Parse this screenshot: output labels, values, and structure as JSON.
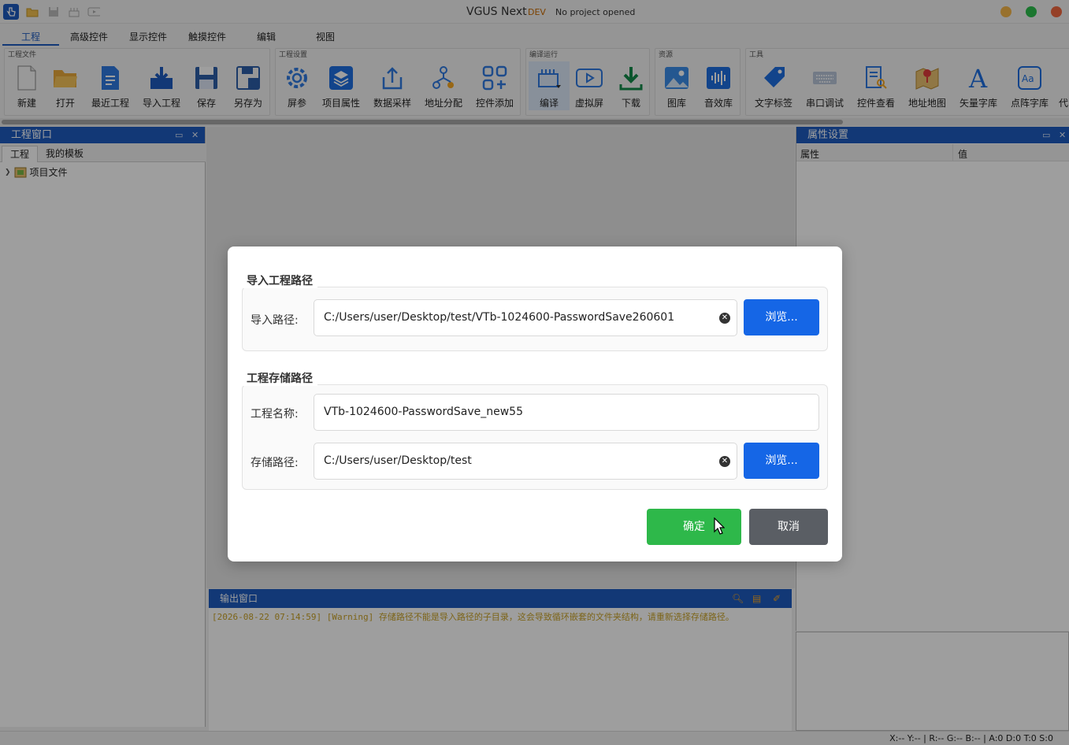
{
  "titlebar": {
    "app_name": "VGUS Next",
    "badge": "DEV",
    "project_status": "No project opened",
    "quick_access": [
      "app-logo-icon",
      "open-folder-icon",
      "save-icon",
      "build-icon",
      "preview-icon"
    ],
    "window_buttons": {
      "minimize": "#f5b64a",
      "maximize": "#2cbf4c",
      "close": "#f0683f"
    }
  },
  "menu": {
    "tabs": [
      "工程",
      "高级控件",
      "显示控件",
      "触摸控件",
      "编辑",
      "视图"
    ],
    "active": "工程"
  },
  "ribbon": {
    "groups": [
      {
        "label": "工程文件",
        "items": [
          "新建",
          "打开",
          "最近工程",
          "导入工程",
          "保存",
          "另存为"
        ]
      },
      {
        "label": "工程设置",
        "items": [
          "屏参",
          "项目属性",
          "数据采样",
          "地址分配",
          "控件添加"
        ]
      },
      {
        "label": "编译运行",
        "items": [
          "编译",
          "虚拟屏",
          "下载"
        ]
      },
      {
        "label": "资源",
        "items": [
          "图库",
          "音效库"
        ]
      },
      {
        "label": "工具",
        "items": [
          "文字标签",
          "串口调试",
          "控件查看",
          "地址地图",
          "矢量字库",
          "点阵字库",
          "代"
        ]
      }
    ]
  },
  "left_panel": {
    "title": "工程窗口",
    "tabs": [
      "工程",
      "我的模板"
    ],
    "tree": [
      {
        "label": "项目文件"
      }
    ]
  },
  "right_panel": {
    "title": "属性设置",
    "columns": [
      "属性",
      "值"
    ]
  },
  "output": {
    "title": "输出窗口",
    "message": "[2026-08-22 07:14:59] [Warning] 存储路径不能是导入路径的子目录，这会导致循环嵌套的文件夹结构，请重新选择存储路径。"
  },
  "status": {
    "text": "X:--  Y:--  |  R:-- G:-- B:--  |  A:0  D:0  T:0  S:0"
  },
  "dialog": {
    "import_section": {
      "legend": "导入工程路径",
      "path_label": "导入路径:",
      "path_value": "C:/Users/user/Desktop/test/VTb-1024600-PasswordSave260601",
      "browse": "浏览..."
    },
    "save_section": {
      "legend": "工程存储路径",
      "name_label": "工程名称:",
      "name_value": "VTb-1024600-PasswordSave_new55",
      "path_label": "存储路径:",
      "path_value": "C:/Users/user/Desktop/test",
      "browse": "浏览..."
    },
    "ok": "确定",
    "cancel": "取消"
  }
}
